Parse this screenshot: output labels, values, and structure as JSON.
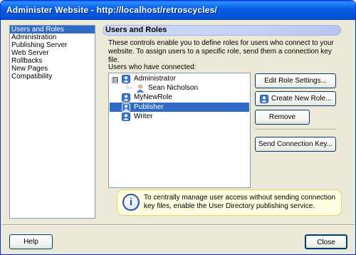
{
  "window": {
    "title": "Administer Website - http://localhost/retroscycles/"
  },
  "sidebar": {
    "items": [
      {
        "label": "Users and Roles",
        "selected": true
      },
      {
        "label": "Administration",
        "selected": false
      },
      {
        "label": "Publishing Server",
        "selected": false
      },
      {
        "label": "Web Server",
        "selected": false
      },
      {
        "label": "Rollbacks",
        "selected": false
      },
      {
        "label": "New Pages",
        "selected": false
      },
      {
        "label": "Compatibility",
        "selected": false
      }
    ]
  },
  "main": {
    "header": "Users and Roles",
    "description": "These controls enable you to define roles for users who connect to your website. To assign users to a specific role, send them a connection key file.",
    "users_label": "Users who have connected:",
    "roles": [
      {
        "label": "Administrator",
        "expanded": true,
        "expander": "⊟",
        "children": [
          {
            "label": "Sean Nicholson"
          }
        ]
      },
      {
        "label": "MyNewRole"
      },
      {
        "label": "Publisher",
        "selected": true
      },
      {
        "label": "Writer"
      }
    ],
    "buttons": {
      "edit_role": "Edit Role Settings...",
      "create_role": "Create New Role...",
      "remove": "Remove",
      "send_key": "Send Connection Key..."
    },
    "info_text": "To centrally manage user access without sending connection key files, enable the User Directory publishing service."
  },
  "footer": {
    "help": "Help",
    "close": "Close"
  },
  "colors": {
    "selection": "#316ac5",
    "titlebar": "#0451d6",
    "info_bg": "#ffffe1"
  }
}
